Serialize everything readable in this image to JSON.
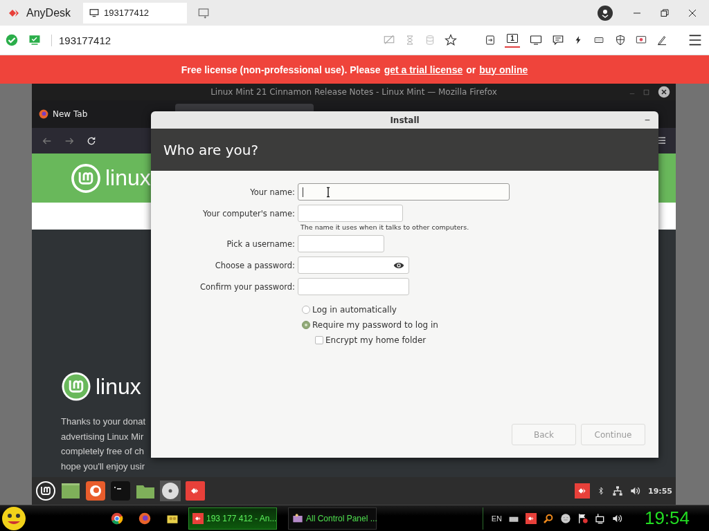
{
  "anydesk": {
    "app_name": "AnyDesk",
    "tab_label": "193177412",
    "address": "193177412",
    "display_number": "1",
    "banner": {
      "text": "Free license (non-professional use). Please",
      "link1": "get a trial license",
      "middle": "or",
      "link2": "buy online"
    }
  },
  "firefox": {
    "title": "Linux Mint 21 Cinnamon Release Notes - Linux Mint — Mozilla Firefox",
    "tab": "New Tab",
    "header_logo": "linux",
    "page_logo": "linux",
    "paragraph_lines": [
      "Thanks to your donat",
      "advertising Linux Mir",
      "completely free of ch",
      "hope you'll enjoy usir"
    ]
  },
  "install": {
    "title": "Install",
    "heading": "Who are you?",
    "fields": [
      {
        "label": "Your name:",
        "kind": "text",
        "focused": true
      },
      {
        "label": "Your computer's name:",
        "kind": "text",
        "focused": false,
        "hint": "The name it uses when it talks to other computers."
      },
      {
        "label": "Pick a username:",
        "kind": "text",
        "focused": false
      },
      {
        "label": "Choose a password:",
        "kind": "password",
        "focused": false
      },
      {
        "label": "Confirm your password:",
        "kind": "text",
        "focused": false
      }
    ],
    "options": [
      {
        "label": "Log in automatically",
        "selected": false
      },
      {
        "label": "Require my password to log in",
        "selected": true
      }
    ],
    "encrypt": {
      "label": "Encrypt my home folder",
      "checked": false
    },
    "buttons": [
      {
        "label": "Back",
        "disabled": true
      },
      {
        "label": "Continue",
        "disabled": true
      }
    ]
  },
  "mint_panel": {
    "clock": "19:55"
  },
  "windows_taskbar": {
    "tasks": [
      {
        "label": "193 177 412 - An...",
        "selected": true
      },
      {
        "label": "All Control Panel ...",
        "selected": false
      }
    ],
    "language": "EN",
    "clock": "19:54"
  }
}
